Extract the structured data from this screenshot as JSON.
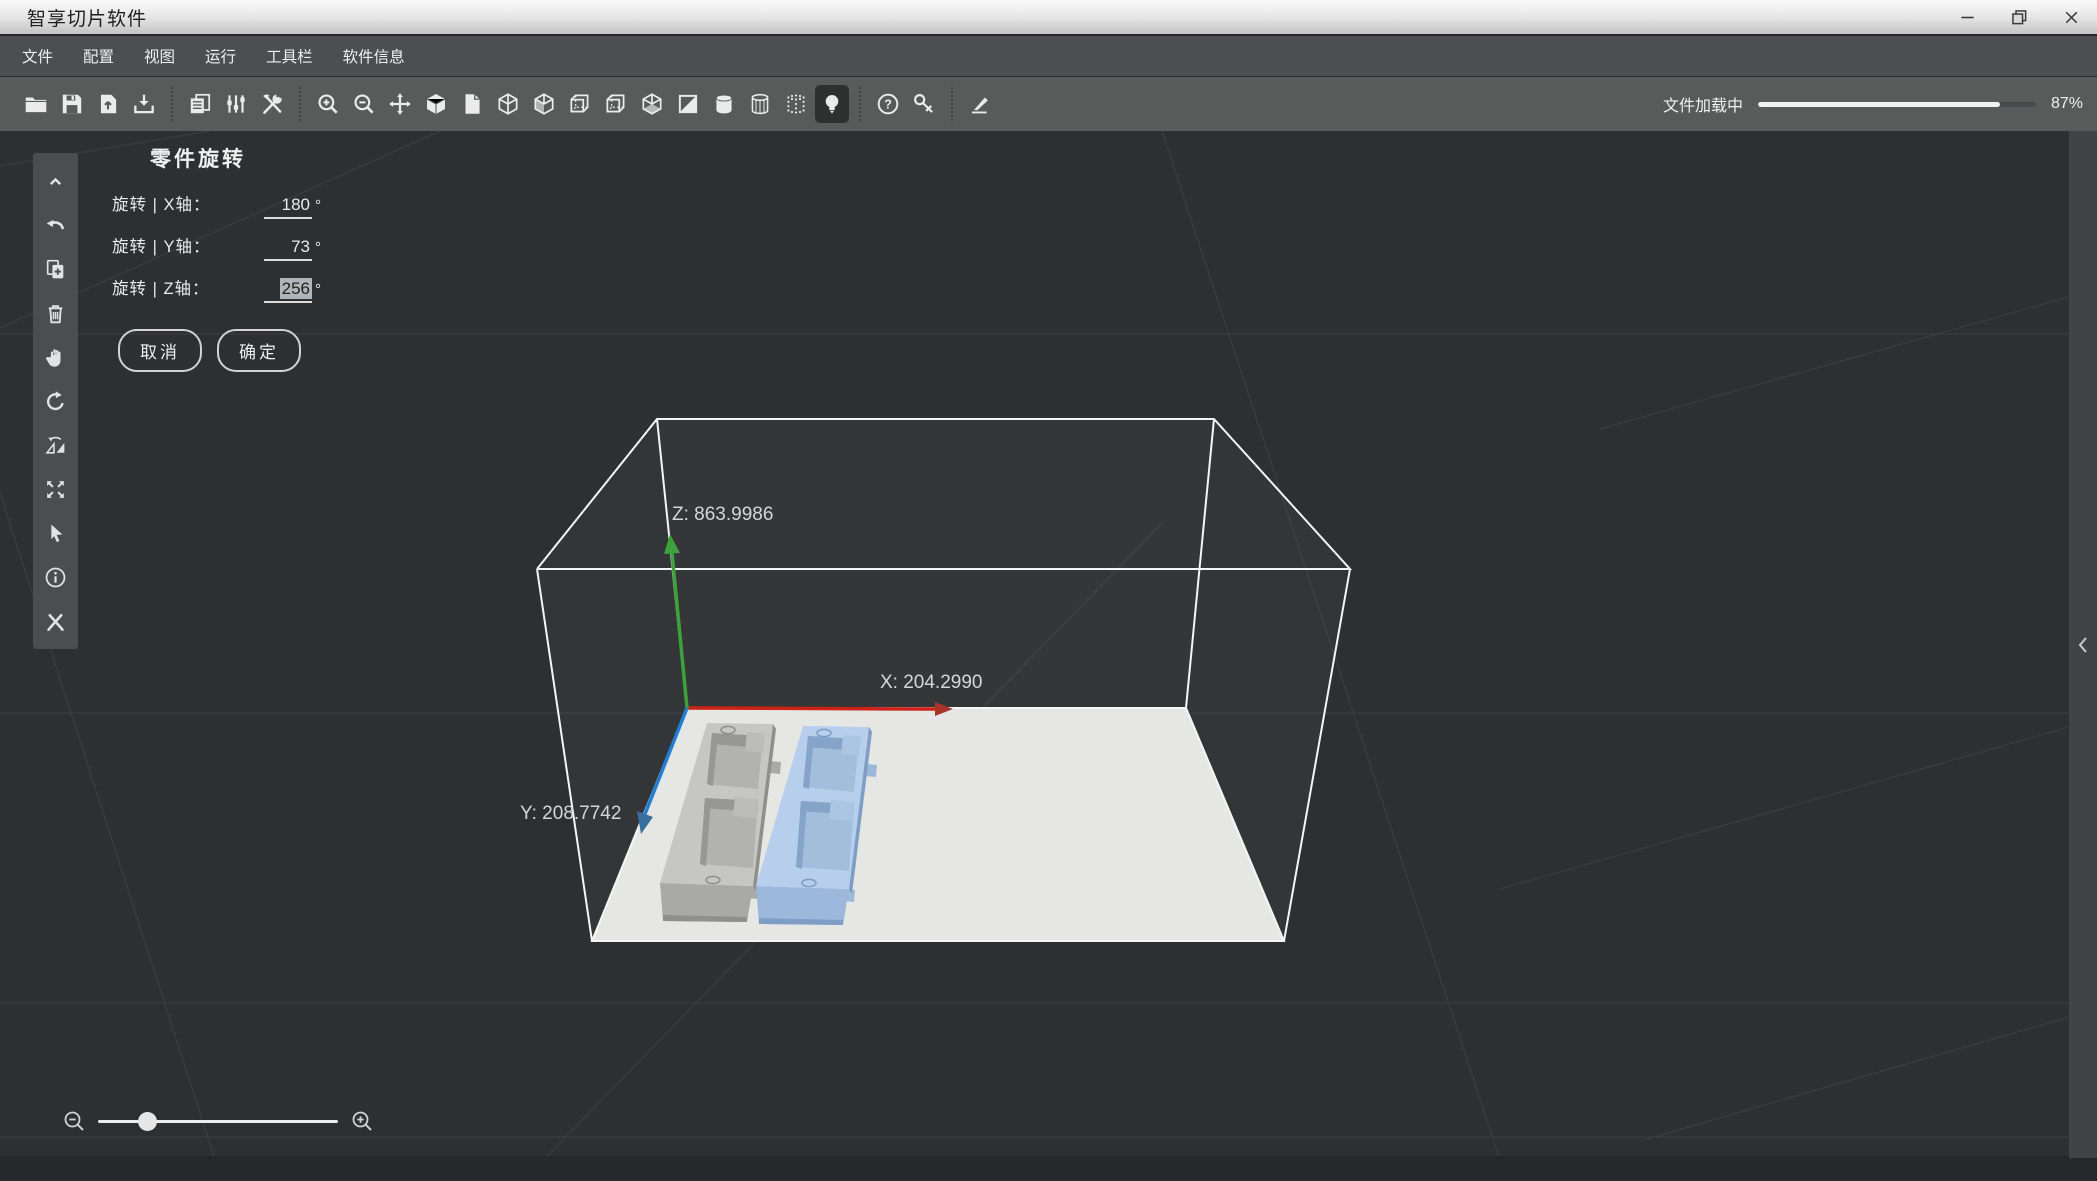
{
  "window": {
    "title": "智享切片软件",
    "controls": {
      "minimize": "minimize",
      "restore": "restore",
      "close": "close"
    }
  },
  "menu": {
    "items": [
      "文件",
      "配置",
      "视图",
      "运行",
      "工具栏",
      "软件信息"
    ]
  },
  "toolbar": {
    "icons": [
      "open-file",
      "save",
      "export-model",
      "import-model",
      "copy-settings",
      "parameter-sliders",
      "tools",
      "zoom-in",
      "zoom-out",
      "move",
      "view-cube-solid",
      "view-sheet",
      "view-cube-wireframe",
      "view-cube-shaded",
      "view-cube-dashed-1",
      "view-cube-dashed-2",
      "view-cube-bottom",
      "view-cube-diagonal",
      "view-cylinder",
      "view-cylinder-wireframe",
      "view-cylinder-points",
      "light-toggle",
      "help",
      "license-key",
      "cut-tool"
    ],
    "active_icon": "light-toggle",
    "progress": {
      "label": "文件加载中",
      "percent": 87,
      "percent_label": "87%"
    }
  },
  "tool_rail": {
    "icons": [
      "collapse-up",
      "undo",
      "duplicate",
      "delete",
      "pan-hand",
      "rotate",
      "mirror",
      "fit-view",
      "select-cursor",
      "info",
      "repair-tools"
    ]
  },
  "rotation_dialog": {
    "title": "零件旋转",
    "rows": [
      {
        "label": "旋转 | X轴：",
        "value": "180",
        "unit": "°",
        "selected": false
      },
      {
        "label": "旋转 | Y轴：",
        "value": "73",
        "unit": "°",
        "selected": false
      },
      {
        "label": "旋转 | Z轴：",
        "value": "256",
        "unit": "°",
        "selected": true
      }
    ],
    "cancel_label": "取消",
    "confirm_label": "确定"
  },
  "scene": {
    "axis_labels": {
      "x": "X: 204.2990",
      "y": "Y: 208.7742",
      "z": "Z: 863.9986"
    },
    "axis_colors": {
      "x": "#cc2218",
      "y": "#1f7fd4",
      "z": "#3da23d"
    },
    "build_plate_color": "#e6e6e5",
    "background_color": "#2d2f30",
    "models": [
      {
        "name": "tray-mold-gray",
        "color": "#c6c6c4"
      },
      {
        "name": "tray-mold-blue",
        "color": "#b7cfec"
      }
    ]
  },
  "right_panel": {
    "collapse_icon": "chevron-left"
  }
}
